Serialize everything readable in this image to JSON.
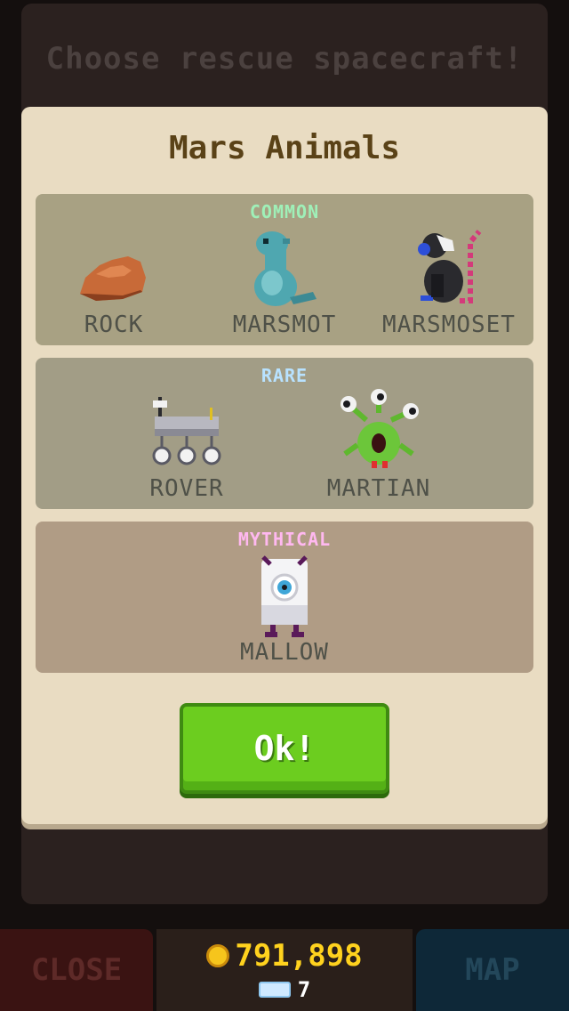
{
  "background": {
    "title": "Choose rescue spacecraft!"
  },
  "modal": {
    "title": "Mars Animals",
    "sections": [
      {
        "rarity": "COMMON",
        "animals": [
          {
            "name": "ROCK",
            "icon": "rock-icon"
          },
          {
            "name": "MARSMOT",
            "icon": "marsmot-icon"
          },
          {
            "name": "MARSMOSET",
            "icon": "marsmoset-icon"
          }
        ]
      },
      {
        "rarity": "RARE",
        "animals": [
          {
            "name": "ROVER",
            "icon": "rover-icon"
          },
          {
            "name": "MARTIAN",
            "icon": "martian-icon"
          }
        ]
      },
      {
        "rarity": "MYTHICAL",
        "animals": [
          {
            "name": "MALLOW",
            "icon": "mallow-icon"
          }
        ]
      }
    ],
    "ok_label": "Ok!"
  },
  "bottom_bar": {
    "close_label": "CLOSE",
    "map_label": "MAP",
    "coins": "791,898",
    "gems": "7"
  },
  "colors": {
    "ok_green": "#6ccd1f",
    "coin_gold": "#ffd21e",
    "common_label": "#9ff0b8",
    "rare_label": "#b8e2ff",
    "mythical_label": "#ffb8f0"
  }
}
